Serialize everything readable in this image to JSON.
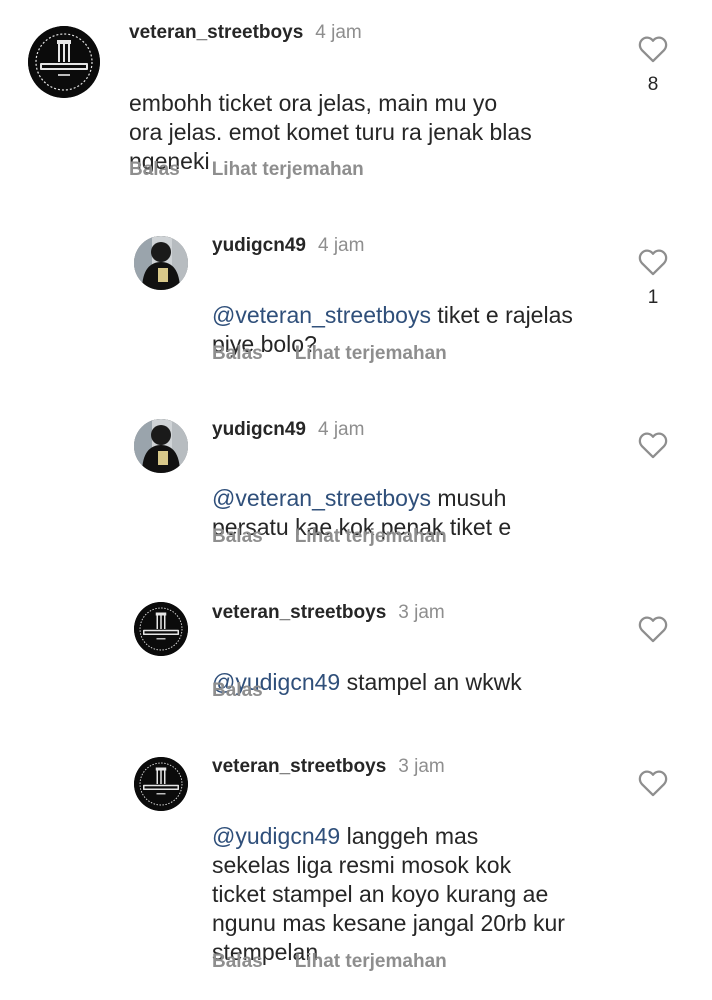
{
  "colors": {
    "text": "#262626",
    "secondary": "#8e8e8e",
    "mention": "#2f4f7a",
    "avatar_bg": "#0b0b0b"
  },
  "icons": {
    "like": "heart-outline-icon",
    "avatar_logo": "veteran-street-logo",
    "avatar_photo": "person-photo"
  },
  "comments": [
    {
      "username": "veteran_streetboys",
      "time": "4 jam",
      "mention": "",
      "text": "embohh ticket ora jelas, main mu yo\nora jelas. emot komet turu ra jenak blas\nngeneki",
      "reply_label": "Balas",
      "translate_label": "Lihat terjemahan",
      "likes": "8"
    },
    {
      "username": "yudigcn49",
      "time": "4 jam",
      "mention": "@veteran_streetboys",
      "text": " tiket e rajelas\npiye bolo?",
      "reply_label": "Balas",
      "translate_label": "Lihat terjemahan",
      "likes": "1"
    },
    {
      "username": "yudigcn49",
      "time": "4 jam",
      "mention": "@veteran_streetboys",
      "text": " musuh\npersatu kae kok penak tiket e",
      "reply_label": "Balas",
      "translate_label": "Lihat terjemahan",
      "likes": ""
    },
    {
      "username": "veteran_streetboys",
      "time": "3 jam",
      "mention": "@yudigcn49",
      "text": "  stampel an wkwk",
      "reply_label": "Balas",
      "translate_label": "",
      "likes": ""
    },
    {
      "username": "veteran_streetboys",
      "time": "3 jam",
      "mention": "@yudigcn49",
      "text": "  langgeh mas\nsekelas liga resmi mosok kok\nticket stampel an koyo kurang ae\nngunu mas kesane jangal 20rb kur\nstempelan",
      "reply_label": "Balas",
      "translate_label": "Lihat terjemahan",
      "likes": ""
    }
  ]
}
